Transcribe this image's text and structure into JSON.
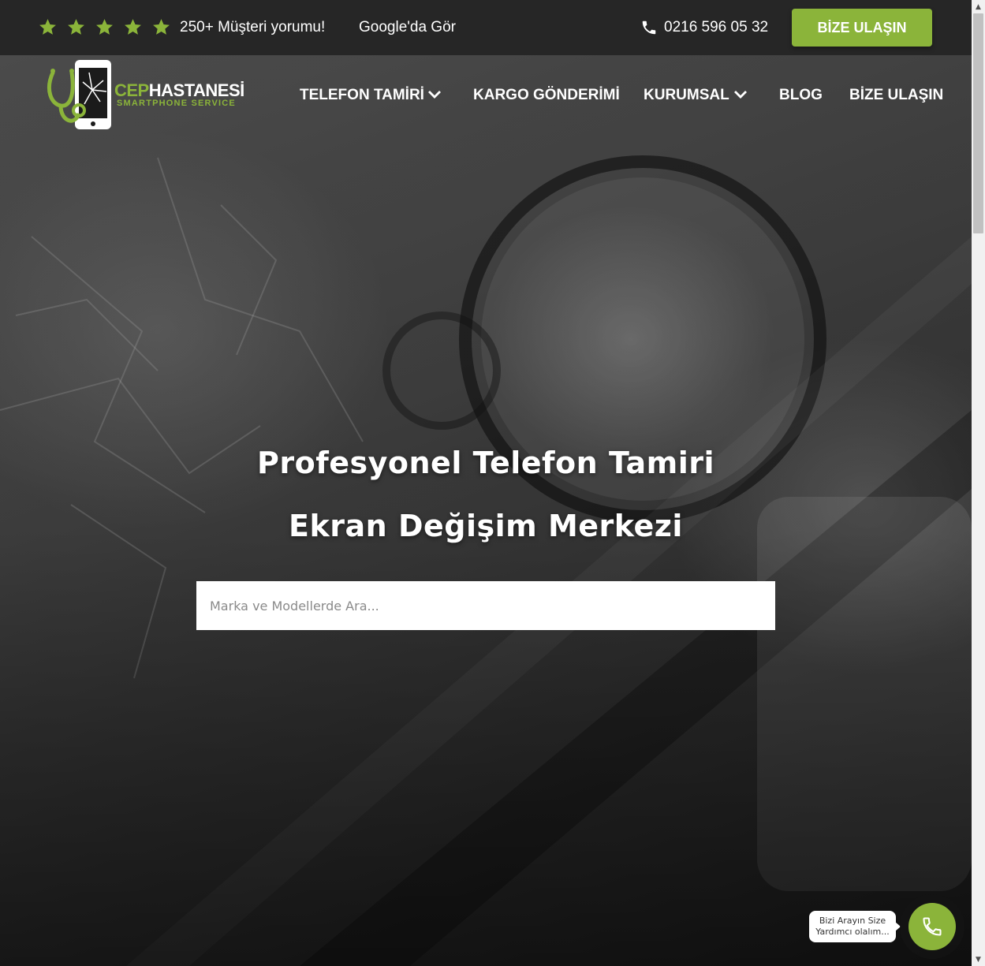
{
  "topbar": {
    "rating_stars": 5,
    "reviews_text": "250+ Müşteri yorumu!",
    "google_link": "Google'da Gör",
    "phone": "0216 596 05 32",
    "cta_label": "BİZE ULAŞIN"
  },
  "logo": {
    "brand_part1": "CEP",
    "brand_part2": "HASTANESİ",
    "tagline": "SMARTPHONE SERVICE"
  },
  "nav": {
    "items": [
      {
        "label": "TELEFON TAMİRİ",
        "has_dropdown": true
      },
      {
        "label": "KARGO GÖNDERİMİ",
        "has_dropdown": false
      },
      {
        "label": "KURUMSAL",
        "has_dropdown": true
      },
      {
        "label": "BLOG",
        "has_dropdown": false
      },
      {
        "label": "BİZE ULAŞIN",
        "has_dropdown": false
      }
    ]
  },
  "hero": {
    "title_line1": "Profesyonel Telefon Tamiri",
    "title_line2": "Ekran Değişim Merkezi",
    "search_placeholder": "Marka ve Modellerde Ara..."
  },
  "call_widget": {
    "tooltip_line1": "Bizi Arayın Size",
    "tooltip_line2": "Yardımcı olalım..."
  },
  "colors": {
    "accent": "#8bb43a",
    "topbar_bg": "#262626",
    "text": "#ffffff"
  },
  "icons": [
    "star-icon",
    "phone-icon",
    "chevron-down-icon",
    "stethoscope-phone-logo",
    "call-icon"
  ]
}
